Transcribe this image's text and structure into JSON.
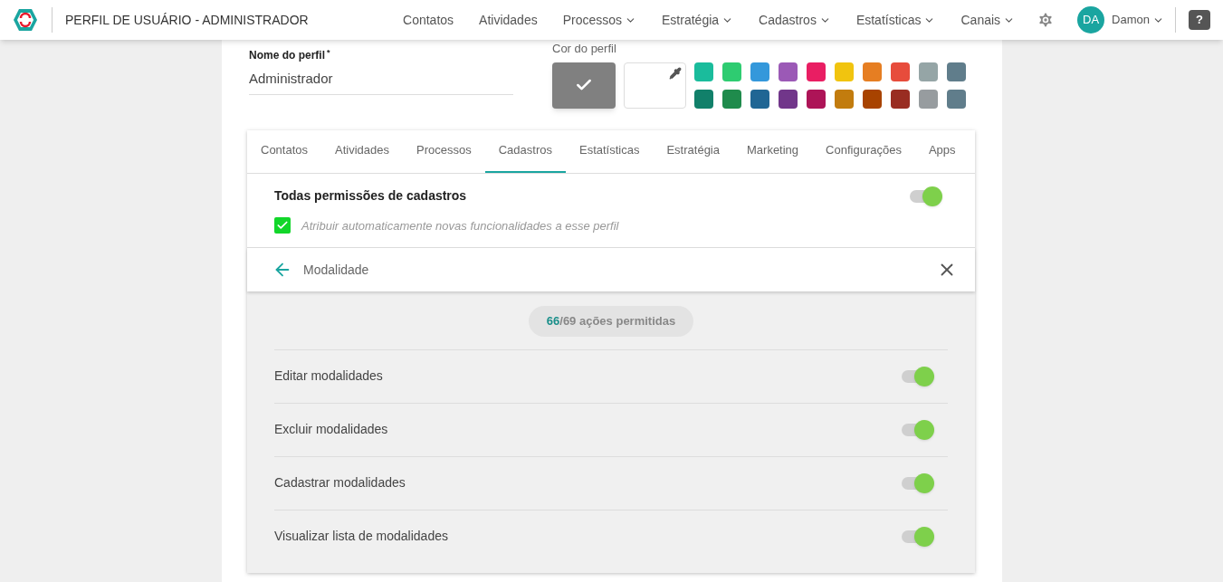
{
  "header": {
    "title": "PERFIL DE USUÁRIO - ADMINISTRADOR",
    "nav": [
      {
        "label": "Contatos",
        "dropdown": false
      },
      {
        "label": "Atividades",
        "dropdown": false
      },
      {
        "label": "Processos",
        "dropdown": true
      },
      {
        "label": "Estratégia",
        "dropdown": true
      },
      {
        "label": "Cadastros",
        "dropdown": true
      },
      {
        "label": "Estatísticas",
        "dropdown": true
      },
      {
        "label": "Canais",
        "dropdown": true
      }
    ],
    "user": {
      "initials": "DA",
      "name": "Damon"
    },
    "help": "?"
  },
  "profile": {
    "name_label": "Nome do perfil",
    "required_mark": "*",
    "name_value": "Administrador",
    "color_label": "Cor do perfil",
    "current": {
      "color": "#808080"
    },
    "swatches": [
      {
        "color": "#1abc9c"
      },
      {
        "color": "#2ecc71"
      },
      {
        "color": "#3498db"
      },
      {
        "color": "#9b59b6"
      },
      {
        "color": "#e91e63"
      },
      {
        "color": "#f1c40f"
      },
      {
        "color": "#e67e22"
      },
      {
        "color": "#e74c3c"
      },
      {
        "color": "#95a5a6"
      },
      {
        "color": "#607d8b"
      },
      {
        "color": "#11806a"
      },
      {
        "color": "#1f8b4c"
      },
      {
        "color": "#206694"
      },
      {
        "color": "#71368a"
      },
      {
        "color": "#ad1457"
      },
      {
        "color": "#c27c0e"
      },
      {
        "color": "#a84300"
      },
      {
        "color": "#992d22"
      },
      {
        "color": "#979c9f"
      },
      {
        "color": "#607d8b"
      }
    ]
  },
  "tabs": [
    {
      "label": "Contatos",
      "selected": false
    },
    {
      "label": "Atividades",
      "selected": false
    },
    {
      "label": "Processos",
      "selected": false
    },
    {
      "label": "Cadastros",
      "selected": true
    },
    {
      "label": "Estatísticas",
      "selected": false
    },
    {
      "label": "Estratégia",
      "selected": false
    },
    {
      "label": "Marketing",
      "selected": false
    },
    {
      "label": "Configurações",
      "selected": false
    },
    {
      "label": "Apps",
      "selected": false
    }
  ],
  "all_permissions": {
    "label": "Todas permissões de cadastros",
    "on": true,
    "auto_assign": {
      "label": "Atribuir automaticamente novas funcionalidades a esse perfil",
      "checked": true
    }
  },
  "section": {
    "title": "Modalidade",
    "allowed": "66",
    "total_text": "/69 ações permitidas",
    "permissions": [
      {
        "label": "Editar modalidades",
        "on": true
      },
      {
        "label": "Excluir modalidades",
        "on": true
      },
      {
        "label": "Cadastrar modalidades",
        "on": true
      },
      {
        "label": "Visualizar lista de modalidades",
        "on": true
      }
    ]
  }
}
